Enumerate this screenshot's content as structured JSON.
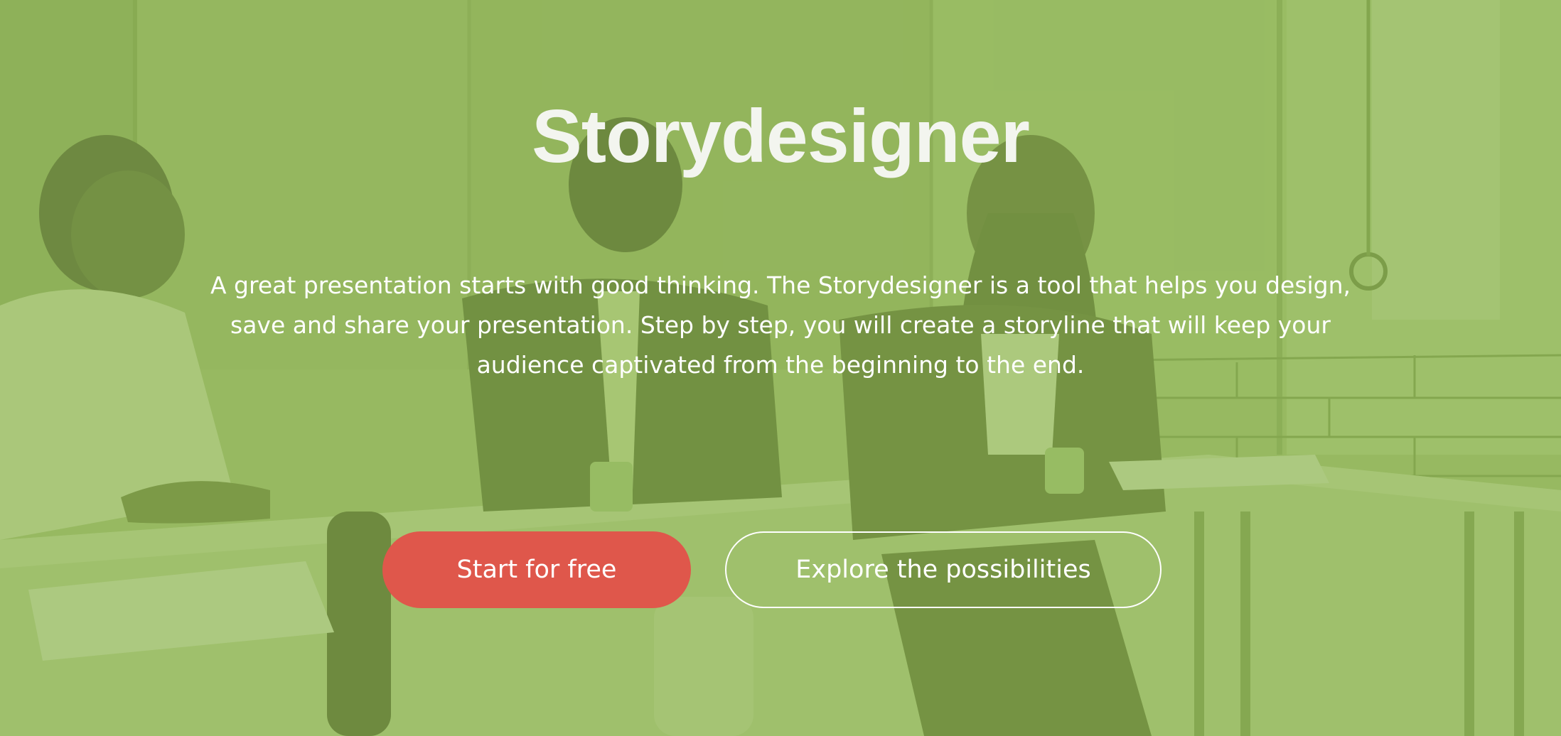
{
  "hero": {
    "title": "Storydesigner",
    "intro": "A great presentation starts with good thinking. The Storydesigner is a tool that helps you design, save and share your presentation. Step by step, you will create a storyline that will keep your audience captivated from the beginning to the end.",
    "primary_button": "Start for free",
    "secondary_button": "Explore the possibilities"
  },
  "colors": {
    "overlay": "#8ab050",
    "primary_button": "#df574b",
    "text": "#ffffff"
  }
}
